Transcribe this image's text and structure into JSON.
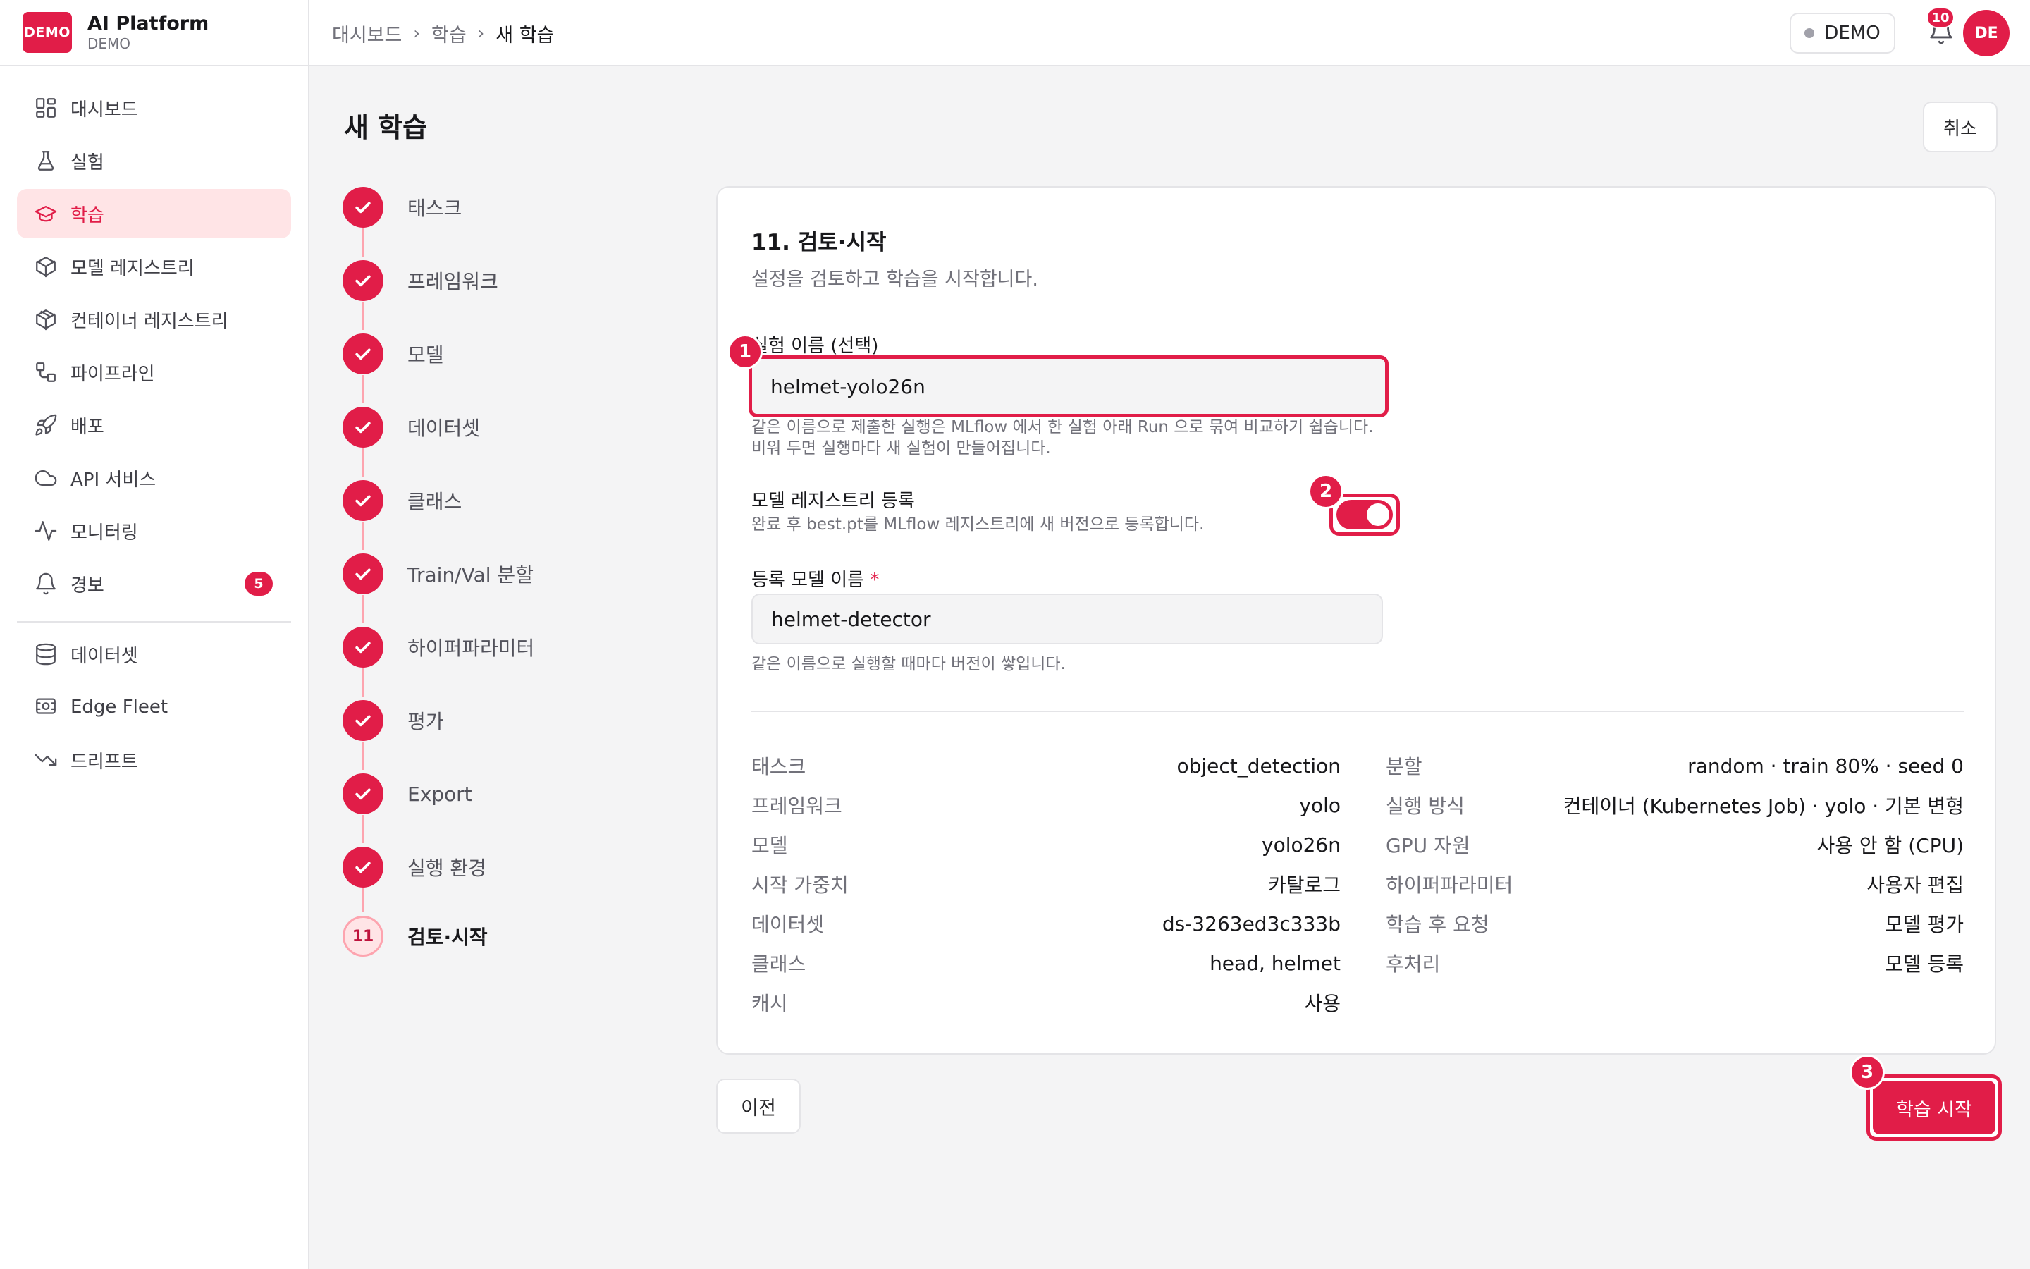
{
  "brand": {
    "logo": "DEMO",
    "name": "AI Platform",
    "sub": "DEMO"
  },
  "sidebar": {
    "items": [
      {
        "label": "대시보드",
        "icon": "dashboard-icon"
      },
      {
        "label": "실험",
        "icon": "flask-icon"
      },
      {
        "label": "학습",
        "icon": "graduation-cap-icon",
        "active": true
      },
      {
        "label": "모델 레지스트리",
        "icon": "cube-icon"
      },
      {
        "label": "컨테이너 레지스트리",
        "icon": "box-icon"
      },
      {
        "label": "파이프라인",
        "icon": "pipeline-icon"
      },
      {
        "label": "배포",
        "icon": "rocket-icon"
      },
      {
        "label": "API 서비스",
        "icon": "cloud-icon"
      },
      {
        "label": "모니터링",
        "icon": "activity-icon"
      },
      {
        "label": "경보",
        "icon": "bell-icon",
        "badge": "5"
      }
    ],
    "items2": [
      {
        "label": "데이터셋",
        "icon": "database-icon"
      },
      {
        "label": "Edge Fleet",
        "icon": "device-icon"
      },
      {
        "label": "드리프트",
        "icon": "trend-down-icon"
      }
    ]
  },
  "topbar": {
    "breadcrumb": [
      "대시보드",
      "학습",
      "새 학습"
    ],
    "env": "DEMO",
    "notifications": "10",
    "avatar": "DE"
  },
  "page": {
    "title": "새 학습",
    "cancel": "취소",
    "prev": "이전",
    "start": "학습 시작"
  },
  "steps": [
    {
      "label": "태스크",
      "done": true
    },
    {
      "label": "프레임워크",
      "done": true
    },
    {
      "label": "모델",
      "done": true
    },
    {
      "label": "데이터셋",
      "done": true
    },
    {
      "label": "클래스",
      "done": true
    },
    {
      "label": "Train/Val 분할",
      "done": true
    },
    {
      "label": "하이퍼파라미터",
      "done": true
    },
    {
      "label": "평가",
      "done": true
    },
    {
      "label": "Export",
      "done": true
    },
    {
      "label": "실행 환경",
      "done": true
    },
    {
      "label": "검토·시작",
      "number": "11",
      "current": true
    }
  ],
  "review": {
    "title": "11. 검토·시작",
    "subtitle": "설정을 검토하고 학습을 시작합니다.",
    "experiment_label": "실험 이름 (선택)",
    "experiment_value": "helmet-yolo26n",
    "experiment_hint1": "같은 이름으로 제출한 실행은 MLflow 에서 한 실험 아래 Run 으로 묶여 비교하기 쉽습니다.",
    "experiment_hint2": "비워 두면 실행마다 새 실험이 만들어집니다.",
    "registry_label": "모델 레지스트리 등록",
    "registry_hint": "완료 후 best.pt를 MLflow 레지스트리에 새 버전으로 등록합니다.",
    "registry_enabled": true,
    "model_name_label": "등록 모델 이름",
    "model_name_required": "*",
    "model_name_value": "helmet-detector",
    "model_name_hint": "같은 이름으로 실행할 때마다 버전이 쌓입니다."
  },
  "summary_left": [
    {
      "key": "태스크",
      "value": "object_detection"
    },
    {
      "key": "프레임워크",
      "value": "yolo"
    },
    {
      "key": "모델",
      "value": "yolo26n"
    },
    {
      "key": "시작 가중치",
      "value": "카탈로그"
    },
    {
      "key": "데이터셋",
      "value": "ds-3263ed3c333b"
    },
    {
      "key": "클래스",
      "value": "head, helmet"
    },
    {
      "key": "캐시",
      "value": "사용"
    }
  ],
  "summary_right": [
    {
      "key": "분할",
      "value": "random · train 80% · seed 0"
    },
    {
      "key": "실행 방식",
      "value": "컨테이너 (Kubernetes Job) · yolo · 기본 변형"
    },
    {
      "key": "GPU 자원",
      "value": "사용 안 함 (CPU)"
    },
    {
      "key": "하이퍼파라미터",
      "value": "사용자 편집"
    },
    {
      "key": "학습 후 요청",
      "value": "모델 평가"
    },
    {
      "key": "후처리",
      "value": "모델 등록"
    }
  ],
  "markers": [
    "1",
    "2",
    "3"
  ],
  "colors": {
    "accent": "#e11d48",
    "accent_soft": "#ffe4e6"
  }
}
